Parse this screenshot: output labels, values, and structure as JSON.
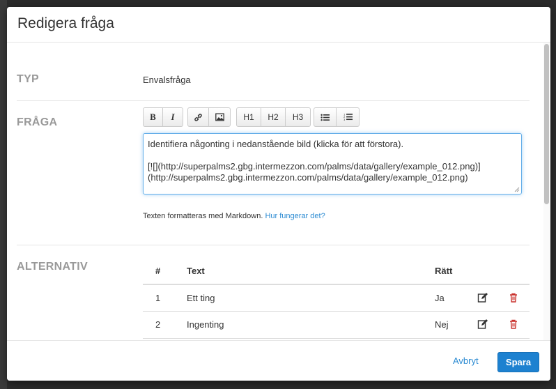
{
  "dialog": {
    "title": "Redigera fråga"
  },
  "type_section": {
    "label": "TYP",
    "value": "Envalsfråga"
  },
  "question_section": {
    "label": "FRÅGA",
    "toolbar": {
      "bold": "B",
      "italic": "I",
      "link_icon": "link-icon",
      "image_icon": "image-icon",
      "h1": "H1",
      "h2": "H2",
      "h3": "H3",
      "bullet_list_icon": "bullet-list-icon",
      "numbered_list_icon": "numbered-list-icon"
    },
    "editor_lines": [
      "Identifiera någonting i nedanstående bild (klicka för att förstora).",
      "",
      "[![](http://superpalms2.gbg.intermezzon.com/palms/data/gallery/example_012.png)]",
      "(http://superpalms2.gbg.intermezzon.com/palms/data/gallery/example_012.png)"
    ],
    "help_text": "Texten formatteras med Markdown.",
    "help_link": "Hur fungerar det?"
  },
  "alternatives_section": {
    "label": "ALTERNATIV",
    "columns": [
      "#",
      "Text",
      "Rätt"
    ],
    "rows": [
      {
        "num": "1",
        "text": "Ett ting",
        "correct": "Ja"
      },
      {
        "num": "2",
        "text": "Ingenting",
        "correct": "Nej"
      }
    ],
    "edit_icon": "edit-icon",
    "delete_icon": "trash-icon"
  },
  "footer": {
    "cancel_label": "Avbryt",
    "save_label": "Spara"
  },
  "colors": {
    "primary": "#1d81d0",
    "link": "#2a8ad2",
    "danger": "#c9302c",
    "focus_border": "#66afe9"
  }
}
